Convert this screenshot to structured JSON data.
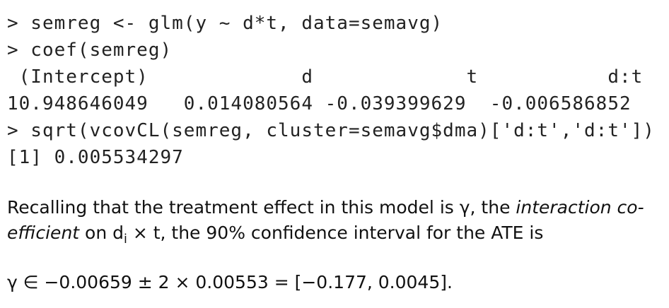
{
  "code": {
    "lines": [
      "> semreg <- glm(y ~ d*t, data=semavg)",
      "> coef(semreg)",
      " (Intercept)             d             t           d:t",
      "10.948646049   0.014080564 -0.039399629  -0.006586852",
      "> sqrt(vcovCL(semreg, cluster=semavg$dma)['d:t','d:t'])",
      "[1] 0.005534297"
    ]
  },
  "paragraph1": {
    "pre": "Recalling that the treatment effect in this model is γ, the ",
    "em1": "interaction co-",
    "em2": "efficient",
    "mid": " on d",
    "sub": "i",
    "post": " × t, the 90% confidence interval for the ATE is"
  },
  "paragraph2": {
    "text": "γ ∈ −0.00659 ± 2 × 0.00553 = [−0.177, 0.0045]."
  }
}
